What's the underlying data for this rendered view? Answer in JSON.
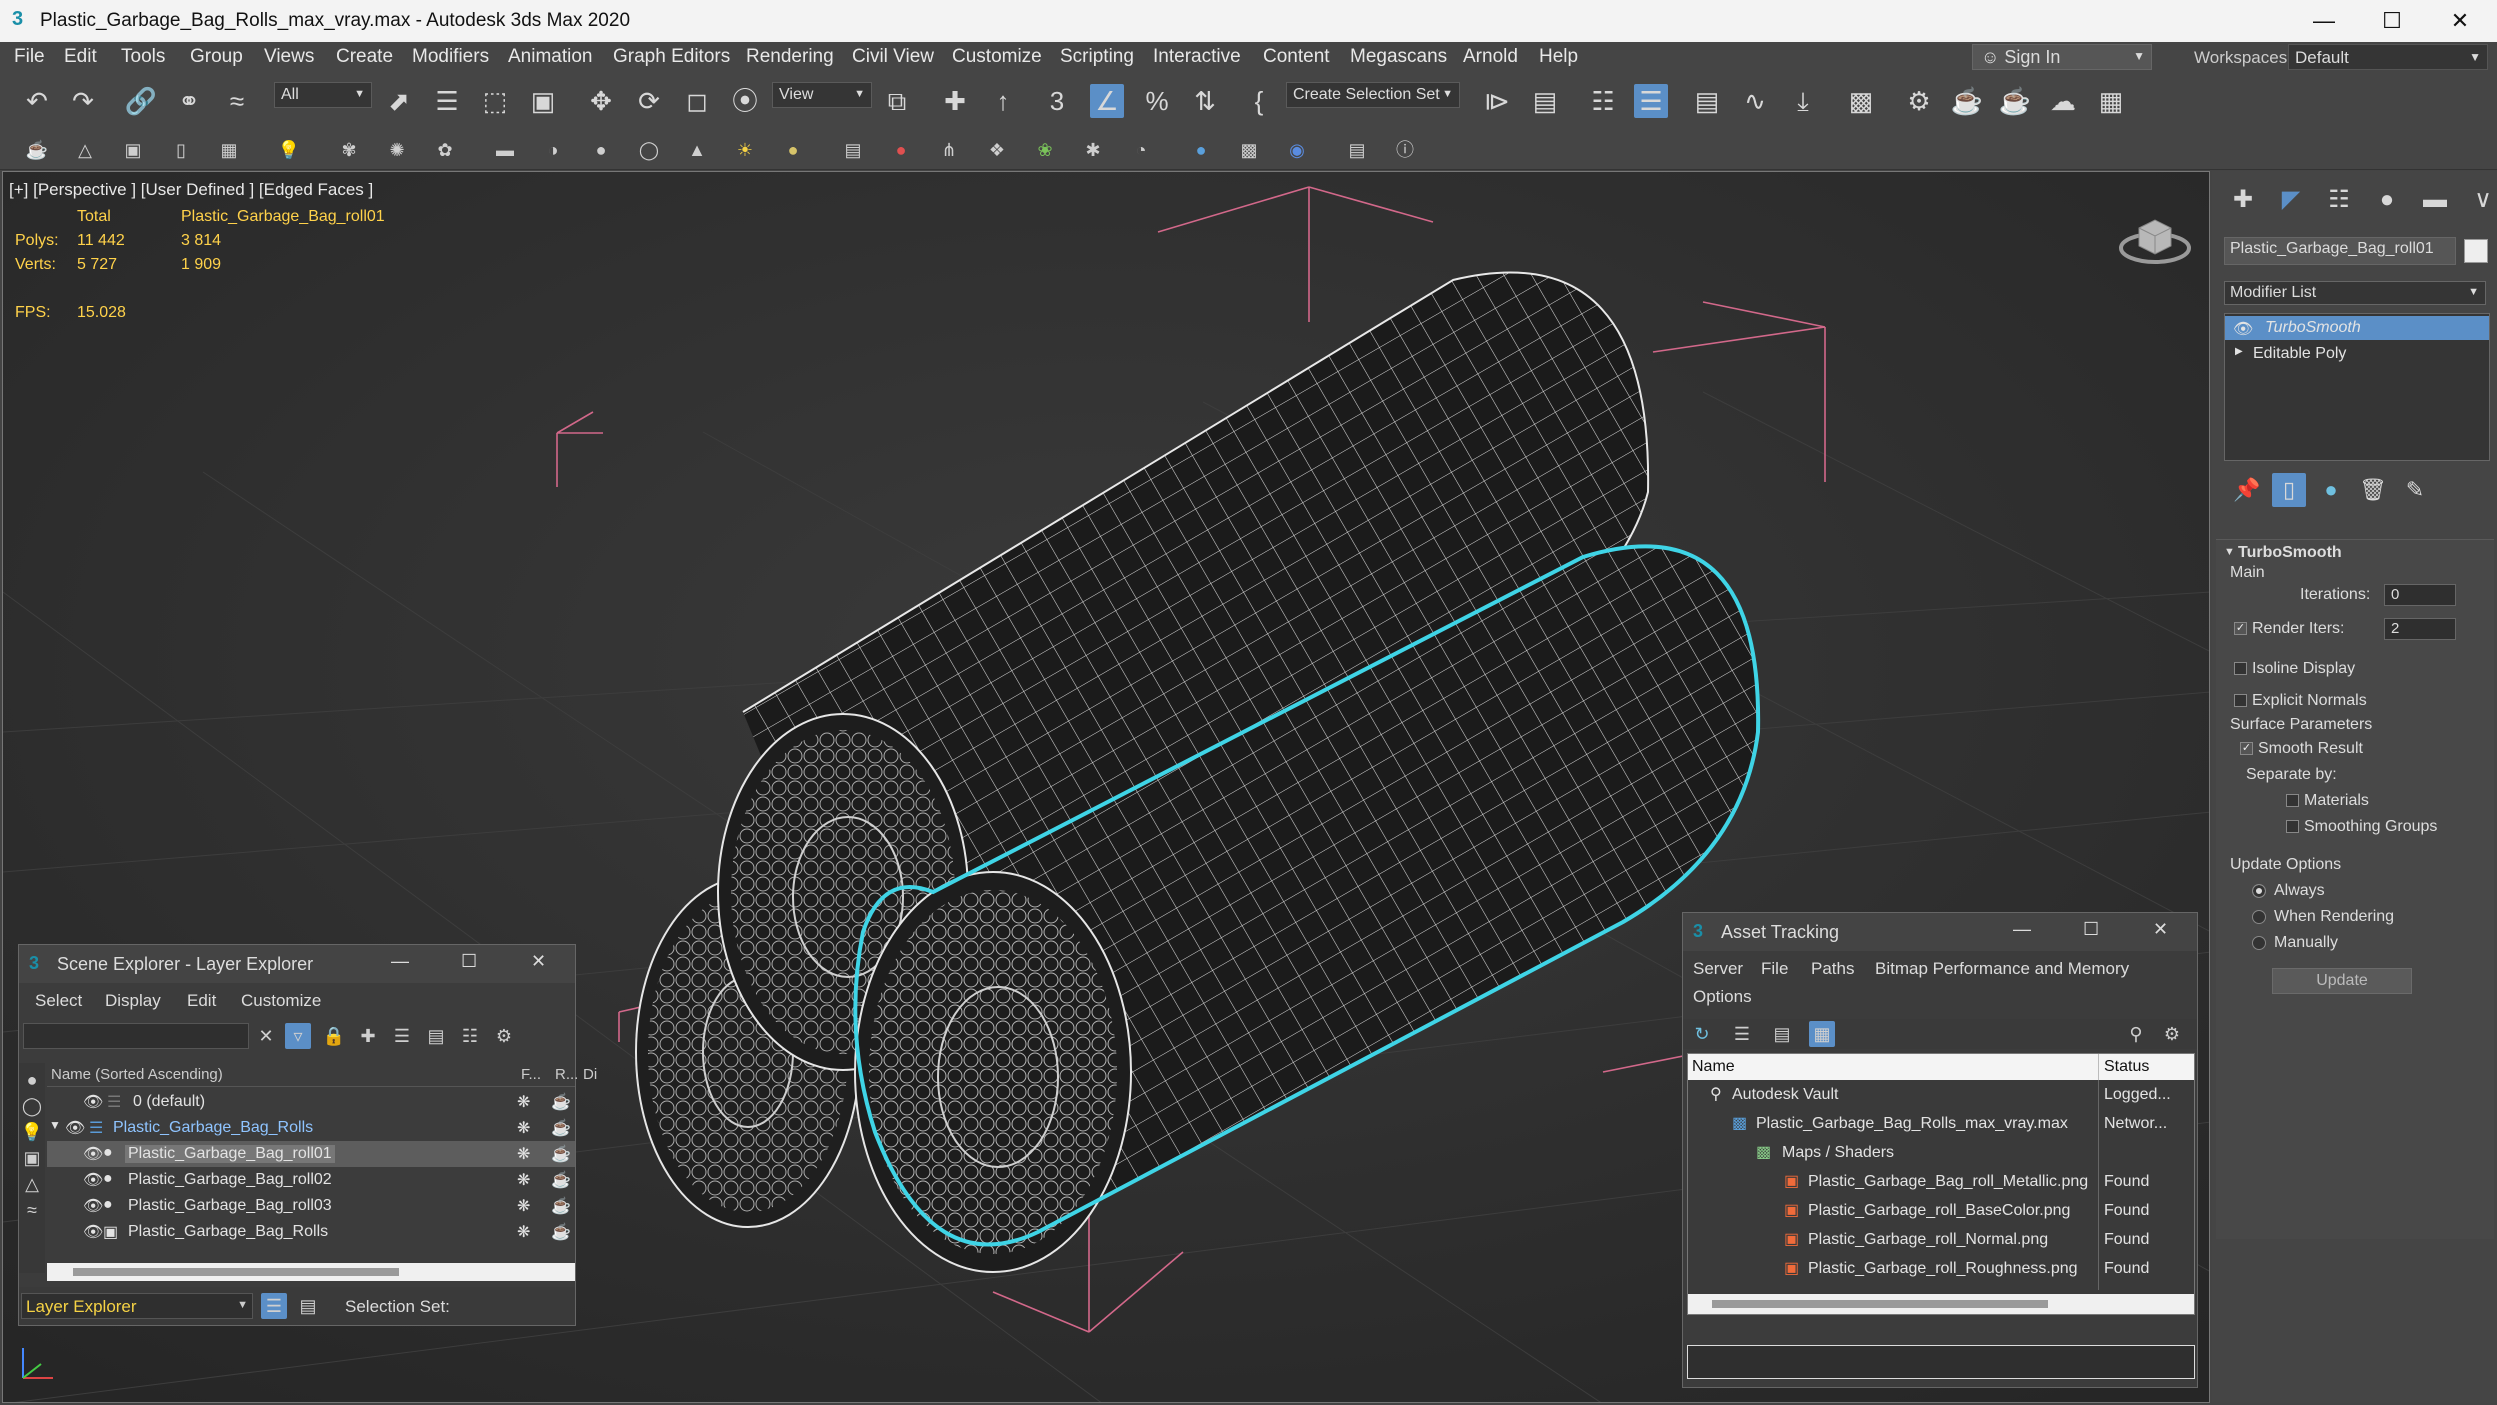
{
  "app": {
    "title": "Plastic_Garbage_Bag_Rolls_max_vray.max - Autodesk 3ds Max 2020",
    "logo_glyph": "3"
  },
  "menu": {
    "items": [
      "File",
      "Edit",
      "Tools",
      "Group",
      "Views",
      "Create",
      "Modifiers",
      "Animation",
      "Graph Editors",
      "Rendering",
      "Civil View",
      "Customize",
      "Scripting",
      "Interactive",
      "Content",
      "Megascans",
      "Arnold",
      "Help"
    ],
    "sign_in": "Sign In",
    "workspaces_label": "Workspaces:",
    "workspace_value": "Default"
  },
  "toolbar": {
    "filter_value": "All",
    "ref_coord_value": "View",
    "selection_set_placeholder": "Create Selection Set",
    "angle_snap_label": "3"
  },
  "viewport": {
    "label": "[+] [Perspective ] [User Defined ] [Edged Faces ]",
    "stats": {
      "total_label": "Total",
      "object_name": "Plastic_Garbage_Bag_roll01",
      "polys_label": "Polys:",
      "polys_total": "11 442",
      "polys_obj": "3 814",
      "verts_label": "Verts:",
      "verts_total": "5 727",
      "verts_obj": "1 909",
      "fps_label": "FPS:",
      "fps_value": "15.028"
    }
  },
  "command_panel": {
    "object_name": "Plastic_Garbage_Bag_roll01",
    "modifier_list": "Modifier List",
    "stack": [
      "TurboSmooth",
      "Editable Poly"
    ],
    "rollout_title": "TurboSmooth",
    "main_label": "Main",
    "iterations_label": "Iterations:",
    "iterations_value": "0",
    "render_iters_label": "Render Iters:",
    "render_iters_value": "2",
    "isoline_label": "Isoline Display",
    "explicit_normals_label": "Explicit Normals",
    "surface_params_label": "Surface Parameters",
    "smooth_result_label": "Smooth Result",
    "separate_by_label": "Separate by:",
    "materials_label": "Materials",
    "smoothing_groups_label": "Smoothing Groups",
    "update_options_label": "Update Options",
    "always_label": "Always",
    "when_rendering_label": "When Rendering",
    "manually_label": "Manually",
    "update_button": "Update"
  },
  "scene_explorer": {
    "title": "Scene Explorer - Layer Explorer",
    "menus": [
      "Select",
      "Display",
      "Edit",
      "Customize"
    ],
    "column_name": "Name (Sorted Ascending)",
    "column_f": "F...",
    "column_r": "R...",
    "column_d": "Di",
    "rows": [
      {
        "label": "0 (default)"
      },
      {
        "label": "Plastic_Garbage_Bag_Rolls"
      },
      {
        "label": "Plastic_Garbage_Bag_roll01"
      },
      {
        "label": "Plastic_Garbage_Bag_roll02"
      },
      {
        "label": "Plastic_Garbage_Bag_roll03"
      },
      {
        "label": "Plastic_Garbage_Bag_Rolls"
      }
    ],
    "footer_mode": "Layer Explorer",
    "selection_set_label": "Selection Set:"
  },
  "asset_tracking": {
    "title": "Asset Tracking",
    "menus": [
      "Server",
      "File",
      "Paths",
      "Bitmap Performance and Memory",
      "Options"
    ],
    "col_name": "Name",
    "col_status": "Status",
    "rows": [
      {
        "name": "Autodesk Vault",
        "status": "Logged..."
      },
      {
        "name": "Plastic_Garbage_Bag_Rolls_max_vray.max",
        "status": "Networ..."
      },
      {
        "name": "Maps / Shaders",
        "status": ""
      },
      {
        "name": "Plastic_Garbage_Bag_roll_Metallic.png",
        "status": "Found"
      },
      {
        "name": "Plastic_Garbage_roll_BaseColor.png",
        "status": "Found"
      },
      {
        "name": "Plastic_Garbage_roll_Normal.png",
        "status": "Found"
      },
      {
        "name": "Plastic_Garbage_roll_Roughness.png",
        "status": "Found"
      }
    ]
  },
  "colors": {
    "selection_outline": "#3fd4e6",
    "stat_text": "#ffd24a",
    "active_blue": "#5b8fc7",
    "layer_highlight": "#5a9bd8"
  }
}
